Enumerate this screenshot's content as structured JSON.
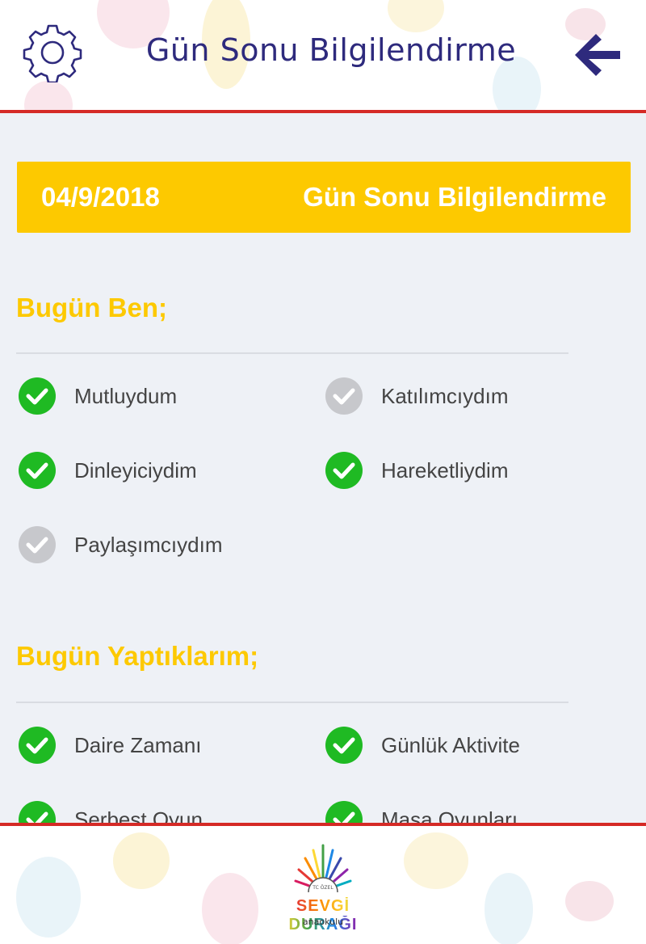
{
  "header": {
    "title": "Gün Sonu Bilgilendirme",
    "settings_icon": "gear-icon",
    "back_icon": "arrow-left-icon",
    "accent_color": "#2e2a7d",
    "line_color": "#d52a26"
  },
  "banner": {
    "date": "04/9/2018",
    "title": "Gün Sonu Bilgilendirme",
    "color": "#fdc900"
  },
  "sections": [
    {
      "title": "Bugün Ben;",
      "items": [
        {
          "label": "Mutluydum",
          "checked": true
        },
        {
          "label": "Katılımcıydım",
          "checked": false
        },
        {
          "label": "Dinleyiciydim",
          "checked": true
        },
        {
          "label": "Hareketliydim",
          "checked": true
        },
        {
          "label": "Paylaşımcıydım",
          "checked": false
        }
      ]
    },
    {
      "title": "Bugün Yaptıklarım;",
      "items": [
        {
          "label": "Daire Zamanı",
          "checked": true
        },
        {
          "label": "Günlük Aktivite",
          "checked": true
        },
        {
          "label": "Serbest Oyun",
          "checked": true
        },
        {
          "label": "Masa Oyunları",
          "checked": true
        }
      ]
    }
  ],
  "footer": {
    "logo_name": "SEVGİ DURAĞI",
    "logo_top": "TC ÖZEL",
    "logo_sub": "anaokulu"
  },
  "colors": {
    "checked": "#1fba23",
    "unchecked": "#c7c8cc",
    "background": "#eef1f6"
  }
}
